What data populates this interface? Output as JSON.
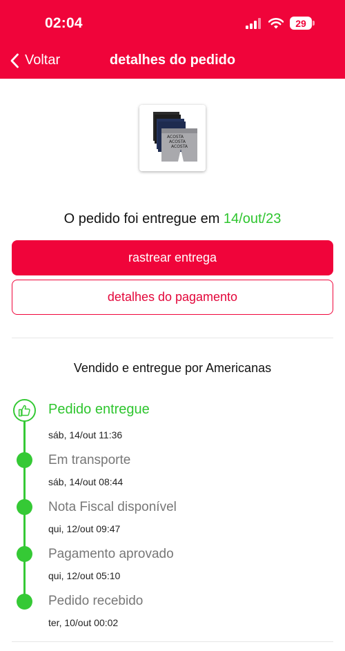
{
  "status_bar": {
    "time": "02:04",
    "battery": "29"
  },
  "nav": {
    "back_label": "Voltar",
    "title": "detalhes do pedido"
  },
  "order": {
    "delivered_prefix": "O pedido foi entregue em",
    "delivered_date": "14/out/23",
    "track_button": "rastrear entrega",
    "payment_button": "detalhes do pagamento",
    "seller_text": "Vendido e entregue por Americanas"
  },
  "timeline": [
    {
      "title": "Pedido entregue",
      "time": "sáb, 14/out 11:36"
    },
    {
      "title": "Em transporte",
      "time": "sáb, 14/out 08:44"
    },
    {
      "title": "Nota Fiscal disponível",
      "time": "qui, 12/out 09:47"
    },
    {
      "title": "Pagamento aprovado",
      "time": "qui, 12/out 05:10"
    },
    {
      "title": "Pedido recebido",
      "time": "ter, 10/out 00:02"
    }
  ],
  "colors": {
    "brand": "#f0043a",
    "success": "#35c935"
  }
}
